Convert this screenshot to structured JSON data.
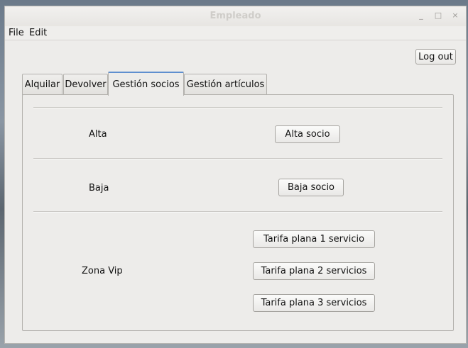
{
  "window": {
    "title": "Empleado",
    "controls": {
      "minimize": "_",
      "maximize": "□",
      "close": "×"
    }
  },
  "menubar": {
    "items": [
      "File",
      "Edit"
    ]
  },
  "toolbar": {
    "logout_label": "Log out"
  },
  "tabs": [
    {
      "label": "Alquilar",
      "active": false
    },
    {
      "label": "Devolver",
      "active": false
    },
    {
      "label": "Gestión socios",
      "active": true
    },
    {
      "label": "Gestión artículos",
      "active": false
    }
  ],
  "socios": {
    "alta": {
      "label": "Alta",
      "button": "Alta socio"
    },
    "baja": {
      "label": "Baja",
      "button": "Baja socio"
    },
    "vip": {
      "label": "Zona Vip",
      "buttons": [
        "Tarifa plana 1 servicio",
        "Tarifa plana 2 servicios",
        "Tarifa plana 3 servicios"
      ]
    }
  }
}
